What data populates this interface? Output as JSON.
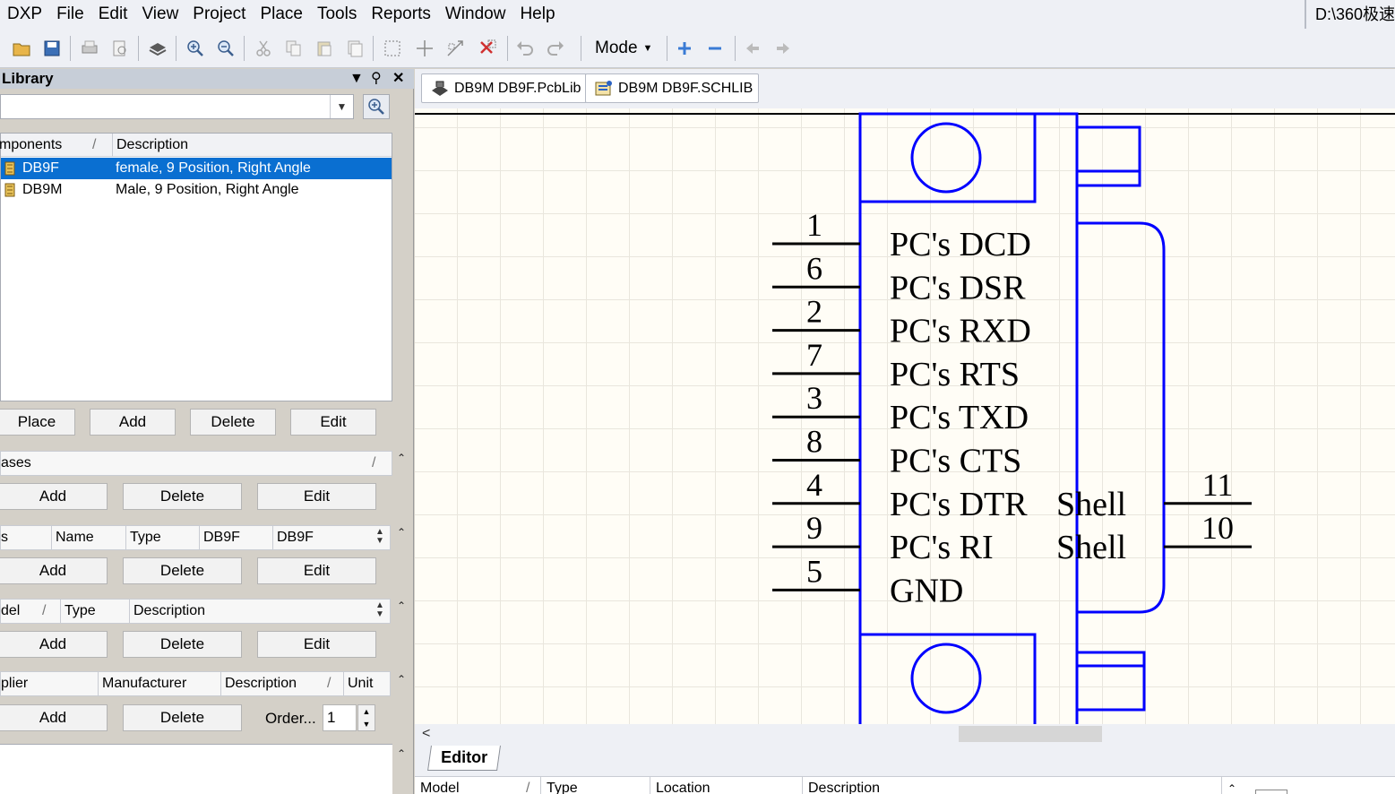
{
  "menu": {
    "items": [
      "DXP",
      "File",
      "Edit",
      "View",
      "Project",
      "Place",
      "Tools",
      "Reports",
      "Window",
      "Help"
    ],
    "path": "D:\\360极速"
  },
  "toolbar": {
    "mode_label": "Mode"
  },
  "library": {
    "title": "Library",
    "filter_value": "",
    "components": {
      "headers": [
        "mponents",
        "Description"
      ],
      "rows": [
        {
          "name": "DB9F",
          "description": "female, 9 Position, Right Angle",
          "selected": true
        },
        {
          "name": "DB9M",
          "description": "Male, 9 Position, Right Angle",
          "selected": false
        }
      ],
      "buttons": [
        "Place",
        "Add",
        "Delete",
        "Edit"
      ]
    },
    "aliases": {
      "header": "ases",
      "buttons": [
        "Add",
        "Delete",
        "Edit"
      ]
    },
    "parameters": {
      "headers": [
        "s",
        "Name",
        "Type",
        "DB9F",
        "DB9F"
      ],
      "buttons": [
        "Add",
        "Delete",
        "Edit"
      ]
    },
    "models": {
      "headers": [
        "del",
        "Type",
        "Description"
      ],
      "buttons": [
        "Add",
        "Delete",
        "Edit"
      ]
    },
    "suppliers": {
      "headers": [
        "plier",
        "Manufacturer",
        "Description",
        "Unit"
      ],
      "buttons": [
        "Add",
        "Delete"
      ],
      "order_label": "Order...",
      "order_value": "1"
    }
  },
  "doc_tabs": [
    {
      "label": "DB9M DB9F.PcbLib"
    },
    {
      "label": "DB9M DB9F.SCHLIB"
    }
  ],
  "schematic": {
    "line_color": "#0000ff",
    "left_pins": [
      {
        "number": "1",
        "name": "PC's DCD"
      },
      {
        "number": "6",
        "name": "PC's DSR"
      },
      {
        "number": "2",
        "name": "PC's RXD"
      },
      {
        "number": "7",
        "name": "PC's RTS"
      },
      {
        "number": "3",
        "name": "PC's TXD"
      },
      {
        "number": "8",
        "name": "PC's CTS"
      },
      {
        "number": "4",
        "name": "PC's DTR"
      },
      {
        "number": "9",
        "name": "PC's RI"
      },
      {
        "number": "5",
        "name": "GND"
      }
    ],
    "right_pins": [
      {
        "number": "11",
        "name": "Shell"
      },
      {
        "number": "10",
        "name": "Shell"
      }
    ]
  },
  "bottom": {
    "editor_tab": "Editor",
    "headers": [
      "Model",
      "Type",
      "Location",
      "Description"
    ]
  }
}
